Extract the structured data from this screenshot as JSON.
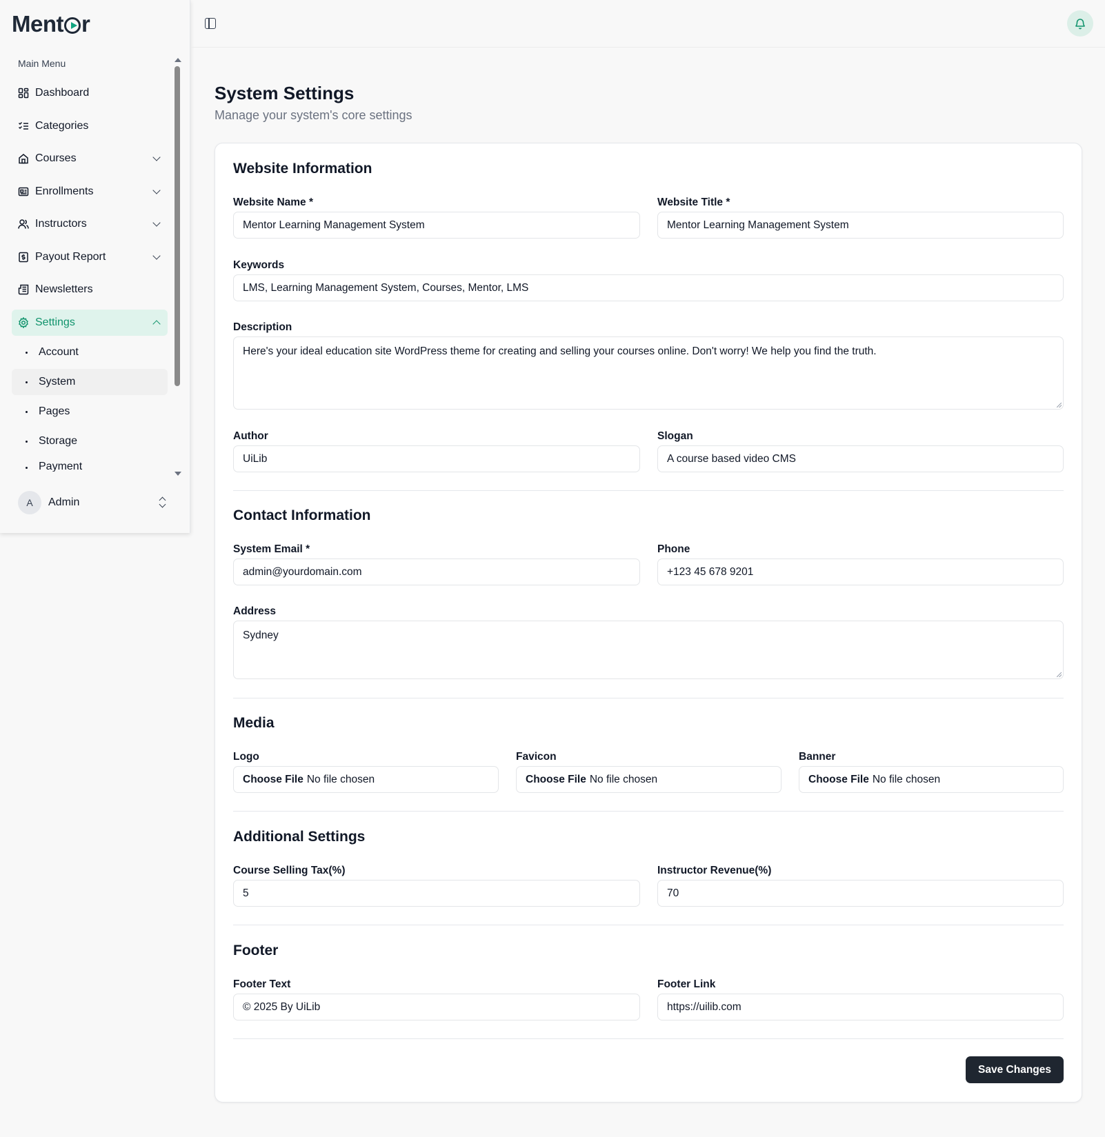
{
  "brand": {
    "logo_text_left": "Ment",
    "logo_text_right": "r"
  },
  "sidebar": {
    "caption": "Main Menu",
    "items": [
      {
        "label": "Dashboard",
        "icon": "dashboard-icon"
      },
      {
        "label": "Categories",
        "icon": "list-check-icon"
      },
      {
        "label": "Courses",
        "icon": "building-icon",
        "expandable": true
      },
      {
        "label": "Enrollments",
        "icon": "id-card-icon",
        "expandable": true
      },
      {
        "label": "Instructors",
        "icon": "users-icon",
        "expandable": true
      },
      {
        "label": "Payout Report",
        "icon": "dollar-receipt-icon",
        "expandable": true
      },
      {
        "label": "Newsletters",
        "icon": "newspaper-icon"
      },
      {
        "label": "Settings",
        "icon": "gear-icon",
        "expandable": true,
        "active": true
      }
    ],
    "settings_sub": [
      "Account",
      "System",
      "Pages",
      "Storage",
      "Payment"
    ],
    "current_sub": "System",
    "user": {
      "initial": "A",
      "name": "Admin"
    }
  },
  "header": {},
  "page": {
    "title": "System Settings",
    "subtitle": "Manage your system's core settings"
  },
  "form": {
    "website": {
      "heading": "Website Information",
      "name_label": "Website Name *",
      "name_value": "Mentor Learning Management System",
      "title_label": "Website Title *",
      "title_value": "Mentor Learning Management System",
      "keywords_label": "Keywords",
      "keywords_value": "LMS, Learning Management System, Courses, Mentor, LMS",
      "description_label": "Description",
      "description_value": "Here's your ideal education site WordPress theme for creating and selling your courses online. Don't worry! We help you find the truth.",
      "author_label": "Author",
      "author_value": "UiLib",
      "slogan_label": "Slogan",
      "slogan_value": "A course based video CMS"
    },
    "contact": {
      "heading": "Contact Information",
      "email_label": "System Email *",
      "email_value": "admin@yourdomain.com",
      "phone_label": "Phone",
      "phone_value": "+123 45 678 9201",
      "address_label": "Address",
      "address_value": "Sydney"
    },
    "media": {
      "heading": "Media",
      "logo_label": "Logo",
      "favicon_label": "Favicon",
      "banner_label": "Banner",
      "choose_file": "Choose File",
      "no_file": "No file chosen"
    },
    "additional": {
      "heading": "Additional Settings",
      "tax_label": "Course Selling Tax(%)",
      "tax_value": "5",
      "revenue_label": "Instructor Revenue(%)",
      "revenue_value": "70"
    },
    "footer": {
      "heading": "Footer",
      "text_label": "Footer Text",
      "text_value": "© 2025 By UiLib",
      "link_label": "Footer Link",
      "link_value": "https://uilib.com"
    },
    "save_label": "Save Changes"
  },
  "colors": {
    "accent": "#10936c",
    "accent_bg": "#dff3ec",
    "button_dark": "#1f2630"
  }
}
